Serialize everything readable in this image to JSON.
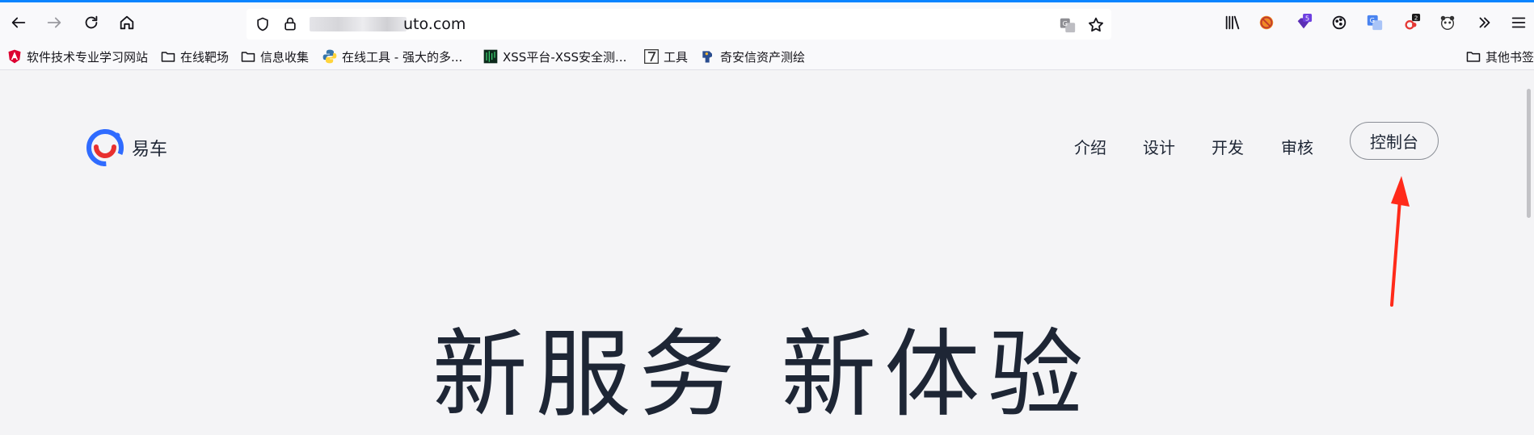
{
  "browser": {
    "url_suffix": "uto.com",
    "accent_color": "#0a84ff",
    "toolbar_icons": [
      "back-icon",
      "forward-icon",
      "reload-icon",
      "home-icon"
    ],
    "right_icons": [
      "library-icon",
      "blocked-addon-icon",
      "purple-addon-icon",
      "cookie-icon",
      "translate-addon-icon",
      "red-dots-addon-icon",
      "panda-addon-icon",
      "overflow-icon",
      "menu-icon"
    ],
    "addon_badges": {
      "purple": "5",
      "red_dots": "2"
    }
  },
  "bookmarks": {
    "items": [
      {
        "label": "软件技术专业学习网站",
        "icon": "angular-icon"
      },
      {
        "label": "在线靶场",
        "icon": "folder-icon"
      },
      {
        "label": "信息收集",
        "icon": "folder-icon"
      },
      {
        "label": "在线工具 - 强大的多...",
        "icon": "python-icon"
      },
      {
        "label": "XSS平台-XSS安全测...",
        "icon": "xss-icon"
      },
      {
        "label": "工具",
        "icon": "seven-icon"
      },
      {
        "label": "奇安信资产测绘",
        "icon": "hunter-icon"
      }
    ],
    "other": "其他书签"
  },
  "site": {
    "brand": "易车",
    "brand_colors": {
      "blue": "#2f6bff",
      "red": "#e8302f"
    },
    "nav": [
      "介绍",
      "设计",
      "开发",
      "审核"
    ],
    "console_button": "控制台",
    "hero_title": "新服务  新体验",
    "annotation_arrow_color": "#ff2a1a"
  }
}
